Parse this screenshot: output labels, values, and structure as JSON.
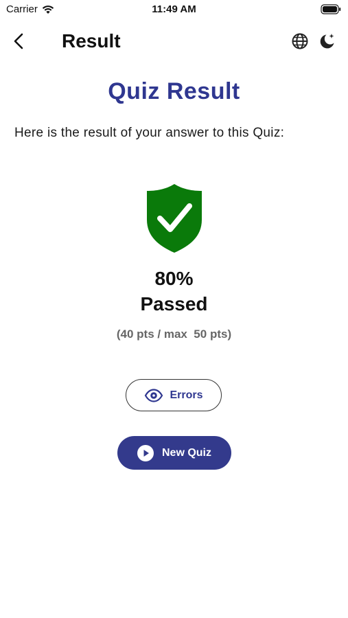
{
  "status_bar": {
    "carrier": "Carrier",
    "time": "11:49 AM",
    "wifi_icon": "wifi-icon",
    "battery_icon": "battery-icon"
  },
  "nav": {
    "back_icon": "chevron-left-icon",
    "title": "Result",
    "language_icon": "globe-icon",
    "theme_icon": "moon-sparkle-icon"
  },
  "content": {
    "heading": "Quiz Result",
    "intro": "Here is the result of your answer to this Quiz:",
    "badge_icon": "shield-check-icon",
    "percent": "80%",
    "status": "Passed",
    "points": "(40 pts / max  50 pts)"
  },
  "actions": {
    "errors_label": "Errors",
    "errors_icon": "eye-icon",
    "new_quiz_label": "New Quiz",
    "new_quiz_icon": "play-circle-icon"
  },
  "colors": {
    "accent": "#2f3790",
    "button_fill": "#333a8c",
    "pass_green": "#0a7a0a",
    "muted_text": "#666666"
  }
}
